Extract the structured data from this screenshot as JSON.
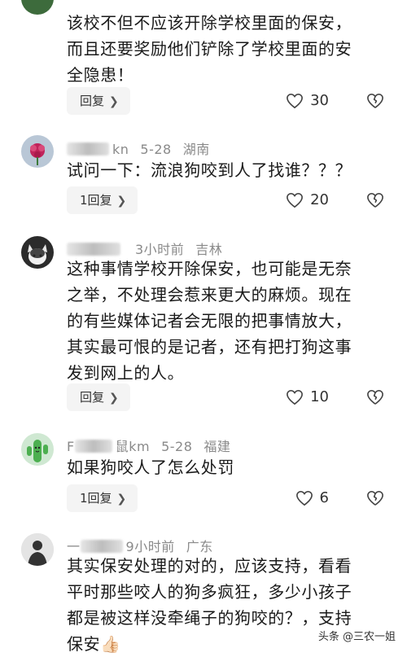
{
  "comments": [
    {
      "meta_name": "",
      "meta_date": "",
      "meta_location": "",
      "text": "该校不但不应该开除学校里面的保安，\n而且还要奖励他们铲除了学校里面的安\n全隐患！",
      "reply_label": "回复",
      "likes": "30"
    },
    {
      "meta_name": "kn",
      "meta_date": "5-28",
      "meta_location": "湖南",
      "text": "试问一下：流浪狗咬到人了找谁？？？",
      "reply_label": "1回复",
      "likes": "20"
    },
    {
      "meta_name": "",
      "meta_date": "3小时前",
      "meta_location": "吉林",
      "text": "这种事情学校开除保安，也可能是无奈\n之举，不处理会惹来更大的麻烦。现在\n的有些媒体记者会无限的把事情放大，\n其实最可恨的是记者，还有把打狗这事\n发到网上的人。",
      "reply_label": "回复",
      "likes": "10"
    },
    {
      "meta_name": "鼠km",
      "meta_date": "5-28",
      "meta_location": "福建",
      "text": "如果狗咬人了怎么处罚",
      "reply_label": "1回复",
      "likes": "6"
    },
    {
      "meta_name": "",
      "meta_date": "9小时前",
      "meta_location": "广东",
      "text": "其实保安处理的对的，应该支持，看看\n平时那些咬人的狗多疯狂，多少小孩子\n都是被这样没牵绳子的狗咬的？，支持\n保安👍🏻",
      "reply_label": "",
      "likes": ""
    }
  ],
  "watermark": "头条 @三农一姐",
  "icons": {
    "like": "heart-outline-icon",
    "dislike": "broken-heart-icon",
    "chevron": "chevron-right-icon"
  },
  "colors": {
    "meta": "#8a8a8a",
    "button_bg": "#f4f4f4",
    "text": "#1a1a1a"
  }
}
